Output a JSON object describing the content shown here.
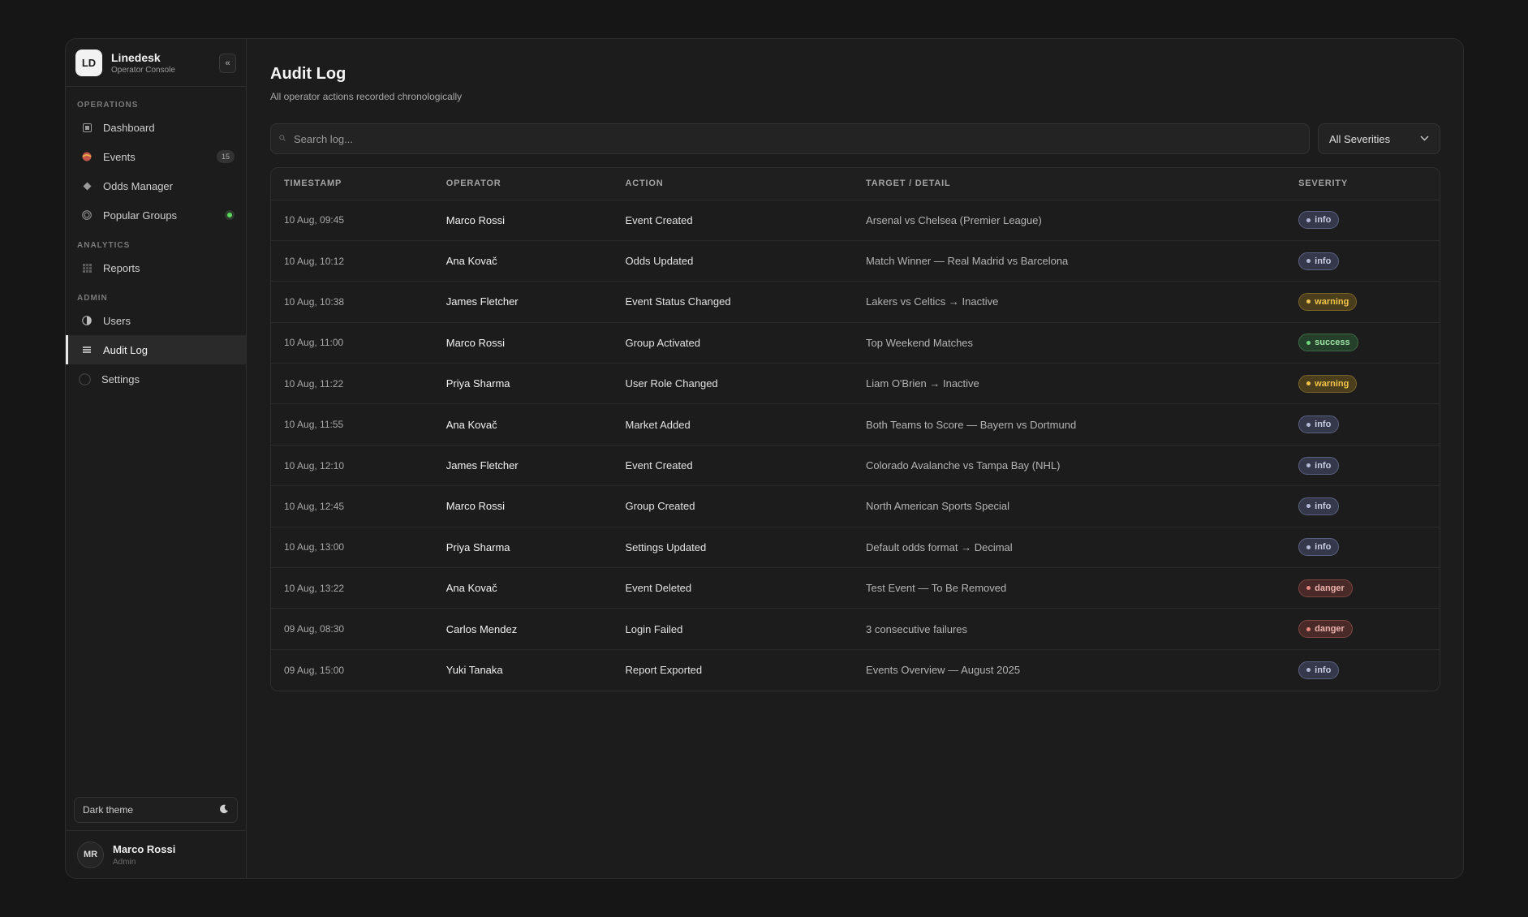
{
  "brand": {
    "initials": "LD",
    "name": "Linedesk",
    "subtitle": "Operator Console",
    "collapse_icon": "«"
  },
  "sidebar": {
    "sections": {
      "operations": "OPERATIONS",
      "analytics": "ANALYTICS",
      "admin": "ADMIN"
    },
    "items": [
      {
        "label": "Dashboard",
        "icon": "dashboard-icon"
      },
      {
        "label": "Events",
        "icon": "events-icon",
        "badge": "15"
      },
      {
        "label": "Odds Manager",
        "icon": "odds-icon"
      },
      {
        "label": "Popular Groups",
        "icon": "groups-icon",
        "status": "online"
      },
      {
        "label": "Reports",
        "icon": "reports-icon"
      },
      {
        "label": "Users",
        "icon": "users-icon"
      },
      {
        "label": "Audit Log",
        "icon": "audit-icon",
        "active": true
      },
      {
        "label": "Settings",
        "icon": "settings-icon"
      }
    ],
    "theme_toggle": "Dark theme",
    "user": {
      "initials": "MR",
      "name": "Marco Rossi",
      "role": "Admin"
    }
  },
  "page": {
    "title": "Audit Log",
    "subtitle": "All operator actions recorded chronologically",
    "search_placeholder": "Search log...",
    "severity_filter": "All Severities"
  },
  "table": {
    "headers": {
      "timestamp": "TIMESTAMP",
      "operator": "OPERATOR",
      "action": "ACTION",
      "target": "TARGET / DETAIL",
      "severity": "SEVERITY"
    },
    "rows": [
      {
        "timestamp": "10 Aug, 09:45",
        "operator": "Marco Rossi",
        "action": "Event Created",
        "target": "Arsenal vs Chelsea (Premier League)",
        "severity": "info"
      },
      {
        "timestamp": "10 Aug, 10:12",
        "operator": "Ana Kovač",
        "action": "Odds Updated",
        "target": "Match Winner — Real Madrid vs Barcelona",
        "severity": "info"
      },
      {
        "timestamp": "10 Aug, 10:38",
        "operator": "James Fletcher",
        "action": "Event Status Changed",
        "target": "Lakers vs Celtics → Inactive",
        "severity": "warning"
      },
      {
        "timestamp": "10 Aug, 11:00",
        "operator": "Marco Rossi",
        "action": "Group Activated",
        "target": "Top Weekend Matches",
        "severity": "success"
      },
      {
        "timestamp": "10 Aug, 11:22",
        "operator": "Priya Sharma",
        "action": "User Role Changed",
        "target": "Liam O'Brien → Inactive",
        "severity": "warning"
      },
      {
        "timestamp": "10 Aug, 11:55",
        "operator": "Ana Kovač",
        "action": "Market Added",
        "target": "Both Teams to Score — Bayern vs Dortmund",
        "severity": "info"
      },
      {
        "timestamp": "10 Aug, 12:10",
        "operator": "James Fletcher",
        "action": "Event Created",
        "target": "Colorado Avalanche vs Tampa Bay (NHL)",
        "severity": "info"
      },
      {
        "timestamp": "10 Aug, 12:45",
        "operator": "Marco Rossi",
        "action": "Group Created",
        "target": "North American Sports Special",
        "severity": "info"
      },
      {
        "timestamp": "10 Aug, 13:00",
        "operator": "Priya Sharma",
        "action": "Settings Updated",
        "target": "Default odds format → Decimal",
        "severity": "info"
      },
      {
        "timestamp": "10 Aug, 13:22",
        "operator": "Ana Kovač",
        "action": "Event Deleted",
        "target": "Test Event — To Be Removed",
        "severity": "danger"
      },
      {
        "timestamp": "09 Aug, 08:30",
        "operator": "Carlos Mendez",
        "action": "Login Failed",
        "target": "3 consecutive failures",
        "severity": "danger"
      },
      {
        "timestamp": "09 Aug, 15:00",
        "operator": "Yuki Tanaka",
        "action": "Report Exported",
        "target": "Events Overview — August 2025",
        "severity": "info"
      }
    ]
  }
}
